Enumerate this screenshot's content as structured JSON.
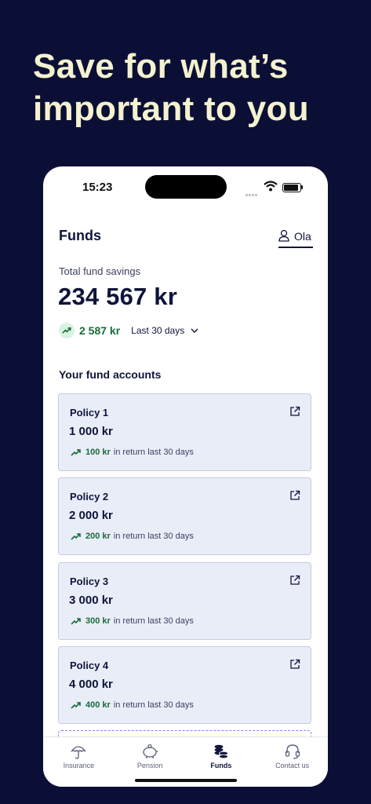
{
  "headline": "Save for what’s important to you",
  "status": {
    "time": "15:23"
  },
  "header": {
    "title": "Funds",
    "user_name": "Ola"
  },
  "summary": {
    "label": "Total fund savings",
    "amount": "234 567 kr",
    "change": "2 587 kr",
    "period": "Last 30 days"
  },
  "section_title": "Your fund accounts",
  "accounts": [
    {
      "name": "Policy 1",
      "amount": "1 000 kr",
      "return_value": "100 kr",
      "return_text": "in return last 30 days"
    },
    {
      "name": "Policy 2",
      "amount": "2 000 kr",
      "return_value": "200 kr",
      "return_text": "in return last 30 days"
    },
    {
      "name": "Policy 3",
      "amount": "3 000 kr",
      "return_value": "300 kr",
      "return_text": "in return last 30 days"
    },
    {
      "name": "Policy 4",
      "amount": "4 000 kr",
      "return_value": "400 kr",
      "return_text": "in return last 30 days"
    }
  ],
  "tabs": [
    {
      "label": "Insurance",
      "icon": "umbrella-icon"
    },
    {
      "label": "Pension",
      "icon": "piggy-bank-icon"
    },
    {
      "label": "Funds",
      "icon": "coins-icon",
      "active": true
    },
    {
      "label": "Contact us",
      "icon": "headset-icon"
    }
  ],
  "colors": {
    "background": "#0c0f35",
    "headline": "#f4f2cf",
    "positive": "#1a6b3a",
    "card": "#e9edf8"
  }
}
